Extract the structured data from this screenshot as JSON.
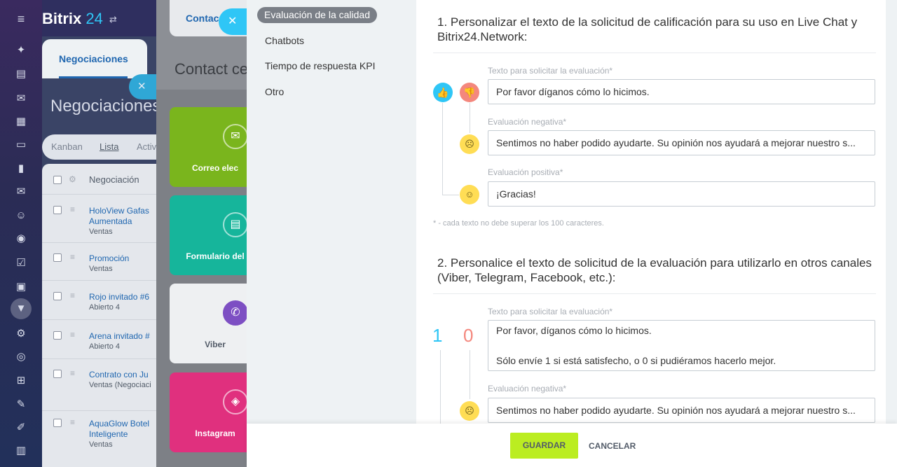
{
  "app": {
    "brand_name": "Bitrix",
    "brand_num": "24"
  },
  "crm": {
    "tab": "Negociaciones",
    "title": "Negociaciones",
    "views": [
      "Kanban",
      "Lista",
      "Activ"
    ],
    "list_header": "Negociación",
    "rows": [
      {
        "name": "HoloView Gafas Aumentada",
        "sub": "Ventas"
      },
      {
        "name": "Promoción",
        "sub": "Ventas"
      },
      {
        "name": "Rojo invitado #6",
        "sub": "Abierto 4"
      },
      {
        "name": "Arena invitado #",
        "sub": "Abierto 4"
      },
      {
        "name": "Contrato con Ju",
        "sub": "Ventas (Negociaci"
      },
      {
        "name": "AquaGlow Botel Inteligente",
        "sub": "Ventas"
      }
    ]
  },
  "contact_center": {
    "tab": "Contac",
    "title": "Contact ce",
    "tiles": [
      {
        "label": "Correo elec",
        "color": "#7ab51d",
        "icon": "envelope-icon"
      },
      {
        "label": "Formulario del",
        "color": "#16b59b",
        "icon": "form-icon"
      },
      {
        "label": "Viber",
        "color": "#eef0f2",
        "icon": "viber-icon"
      },
      {
        "label": "Instagram",
        "color": "#e0307e",
        "icon": "instagram-icon"
      }
    ]
  },
  "settings": {
    "menu": [
      "Evaluación de la calidad",
      "Chatbots",
      "Tiempo de respuesta KPI",
      "Otro"
    ],
    "section1": {
      "title": "1. Personalizar el texto de la solicitud de calificación para su uso en Live Chat y Bitrix24.Network:",
      "request_label": "Texto para solicitar la evaluación*",
      "request_value": "Por favor díganos cómo lo hicimos.",
      "negative_label": "Evaluación negativa*",
      "negative_value": "Sentimos no haber podido ayudarte. Su opinión nos ayudará a mejorar nuestro s...",
      "positive_label": "Evaluación positiva*",
      "positive_value": "¡Gracias!"
    },
    "note": "* - cada texto no debe superar los 100 caracteres.",
    "section2": {
      "title": "2. Personalice el texto de solicitud de la evaluación para utilizarlo en otros canales (Viber, Telegram, Facebook, etc.):",
      "request_label": "Texto para solicitar la evaluación*",
      "request_line1": "Por favor, díganos cómo lo hicimos.",
      "request_line2": "Sólo envíe 1 si está satisfecho, o 0 si pudiéramos hacerlo mejor.",
      "positive_digit": "1",
      "negative_digit": "0",
      "negative_label": "Evaluación negativa*",
      "negative_value": "Sentimos no haber podido ayudarte. Su opinión nos ayudará a mejorar nuestro s..."
    },
    "buttons": {
      "save": "GUARDAR",
      "cancel": "CANCELAR"
    },
    "colors": {
      "like": "#2fc6f6",
      "dislike": "#f4877d",
      "smiley": "#ffdd55",
      "save": "#bbed21"
    }
  }
}
